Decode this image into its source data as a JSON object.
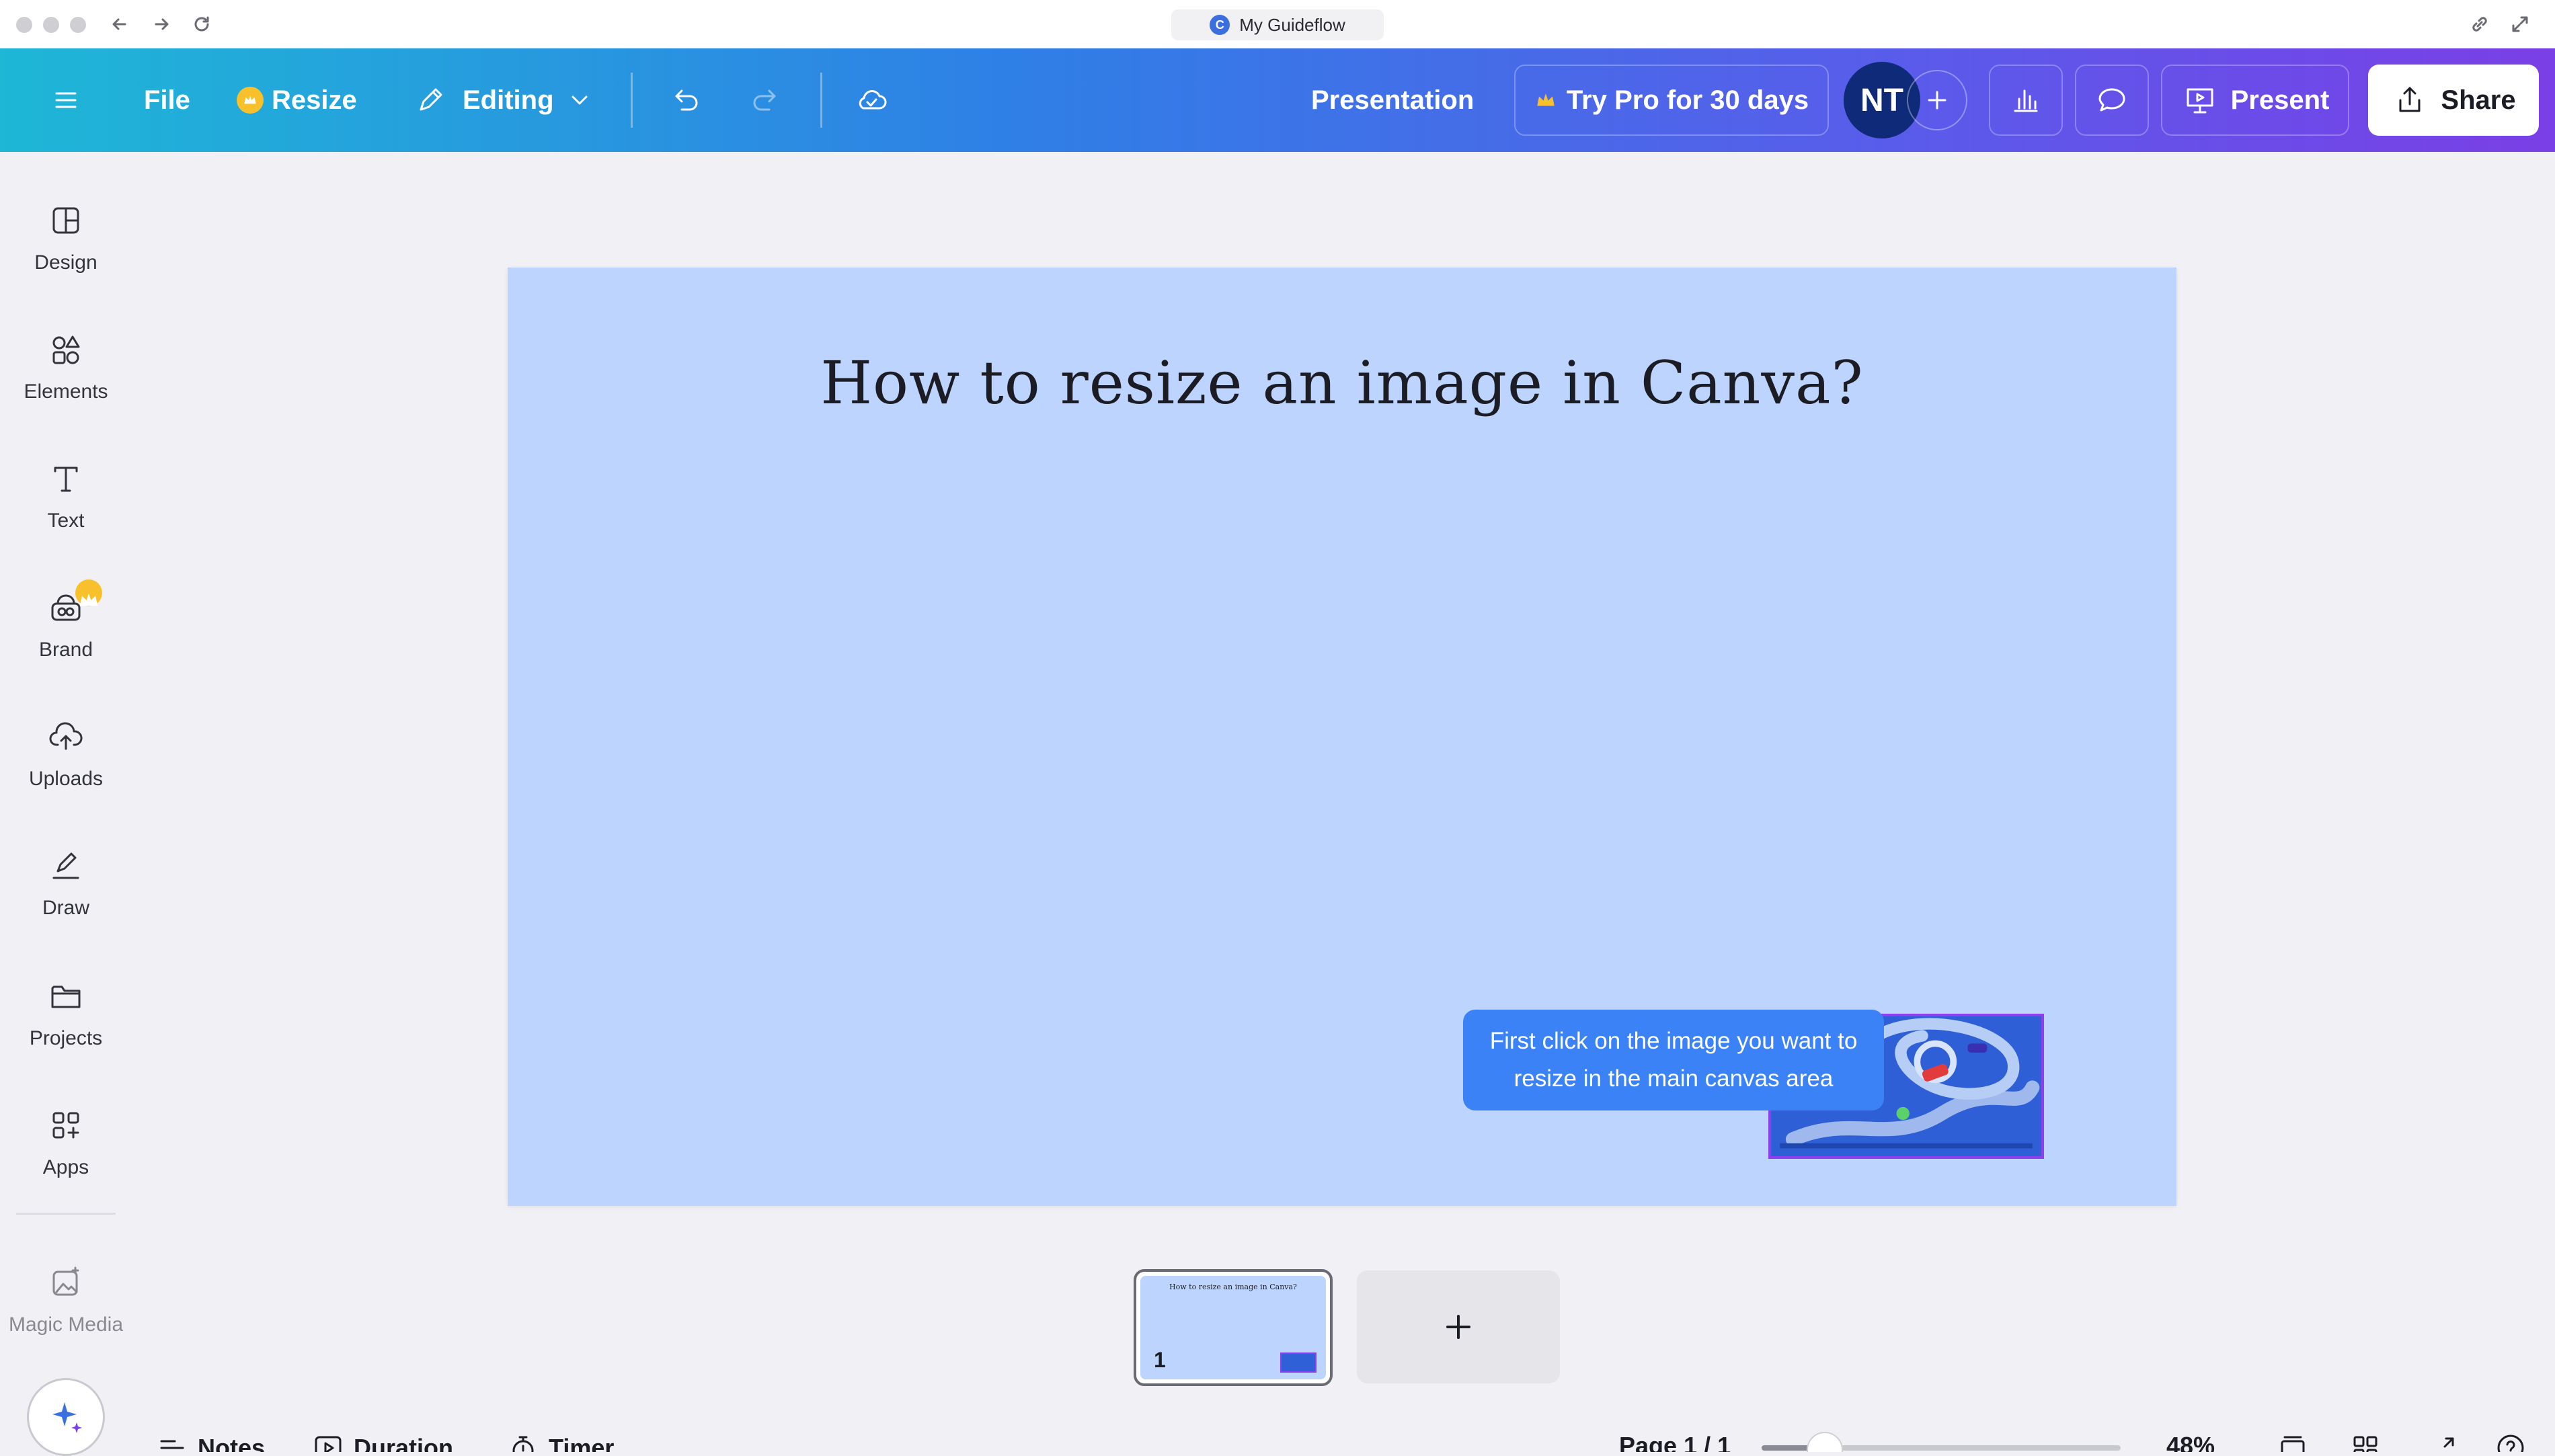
{
  "browser": {
    "title": "My Guideflow"
  },
  "toolbar": {
    "file_label": "File",
    "resize_label": "Resize",
    "editing_label": "Editing",
    "doc_type": "Presentation",
    "try_pro_label": "Try Pro for 30 days",
    "avatar_initials": "NT",
    "present_label": "Present",
    "share_label": "Share"
  },
  "sidebar": {
    "items": [
      {
        "label": "Design",
        "icon": "layout-icon"
      },
      {
        "label": "Elements",
        "icon": "shapes-icon"
      },
      {
        "label": "Text",
        "icon": "text-icon"
      },
      {
        "label": "Brand",
        "icon": "brand-icon"
      },
      {
        "label": "Uploads",
        "icon": "cloud-upload-icon"
      },
      {
        "label": "Draw",
        "icon": "pen-icon"
      },
      {
        "label": "Projects",
        "icon": "folder-icon"
      },
      {
        "label": "Apps",
        "icon": "apps-icon"
      },
      {
        "label": "Magic Media",
        "icon": "magic-media-icon"
      }
    ]
  },
  "canvas": {
    "title": "How to resize an image in Canva?",
    "tooltip": "First click on the image you want to resize in the main canvas area",
    "thumb_title": "How to resize an image in Canva?"
  },
  "pages": {
    "current_number": "1"
  },
  "bottom_bar": {
    "notes_label": "Notes",
    "duration_label": "Duration",
    "timer_label": "Timer",
    "page_indicator": "Page 1 / 1",
    "zoom": "48%",
    "zoom_value": 48
  },
  "colors": {
    "accent": "#3b82f6",
    "slide_bg": "#bcd4fe",
    "pro_crown": "#f8c12c",
    "avatar_bg": "#0e2a78"
  }
}
